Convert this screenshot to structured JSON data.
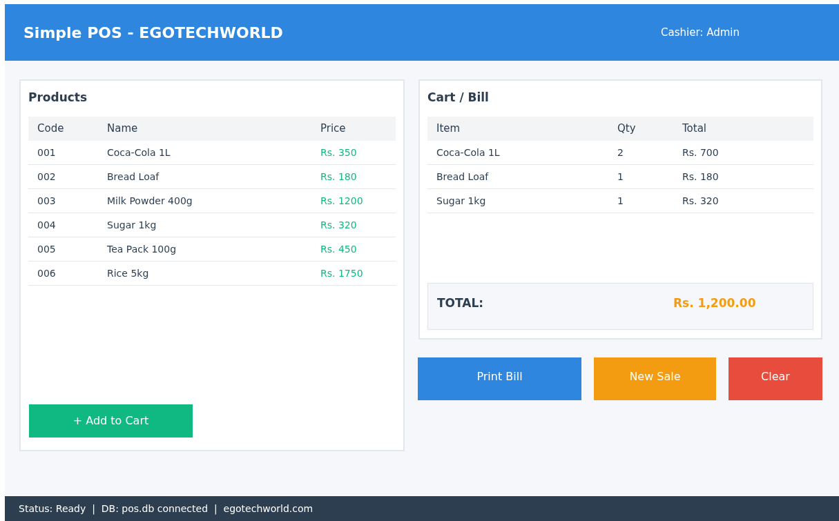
{
  "header": {
    "title": "Simple POS - EGOTECHWORLD",
    "cashier": "Cashier: Admin"
  },
  "products": {
    "title": "Products",
    "columns": [
      "Code",
      "Name",
      "Price"
    ],
    "rows": [
      {
        "code": "001",
        "name": "Coca-Cola 1L",
        "price": "Rs. 350"
      },
      {
        "code": "002",
        "name": "Bread Loaf",
        "price": "Rs. 180"
      },
      {
        "code": "003",
        "name": "Milk Powder 400g",
        "price": "Rs. 1200"
      },
      {
        "code": "004",
        "name": "Sugar 1kg",
        "price": "Rs. 320"
      },
      {
        "code": "005",
        "name": "Tea Pack 100g",
        "price": "Rs. 450"
      },
      {
        "code": "006",
        "name": "Rice 5kg",
        "price": "Rs. 1750"
      }
    ],
    "add_button": "+ Add to Cart"
  },
  "cart": {
    "title": "Cart / Bill",
    "columns": [
      "Item",
      "Qty",
      "Total"
    ],
    "rows": [
      {
        "item": "Coca-Cola 1L",
        "qty": "2",
        "total": "Rs. 700"
      },
      {
        "item": "Bread Loaf",
        "qty": "1",
        "total": "Rs. 180"
      },
      {
        "item": "Sugar 1kg",
        "qty": "1",
        "total": "Rs. 320"
      }
    ],
    "total_label": "TOTAL:",
    "total_value": "Rs. 1,200.00"
  },
  "buttons": [
    {
      "label": "Print Bill",
      "color": "#2e86de"
    },
    {
      "label": "New Sale",
      "color": "#f39c12"
    },
    {
      "label": "Clear",
      "color": "#e74c3c"
    }
  ],
  "status_bar": "Status: Ready  |  DB: pos.db connected  |  egotechworld.com"
}
